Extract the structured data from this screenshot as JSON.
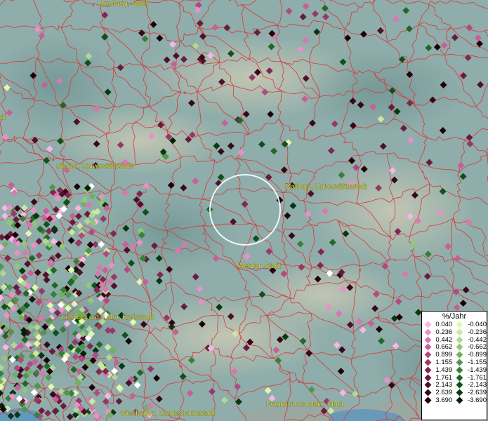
{
  "legend": {
    "title": "%/Jahr",
    "rows": [
      {
        "pos": "0.040",
        "pos_color": "#f6b6e6",
        "neg": "-0.040",
        "neg_color": "#e6f6b0"
      },
      {
        "pos": "0.236",
        "pos_color": "#e890c8",
        "neg": "-0.236",
        "neg_color": "#cce8a0"
      },
      {
        "pos": "0.442",
        "pos_color": "#d878b0",
        "neg": "-0.442",
        "neg_color": "#b0d890"
      },
      {
        "pos": "0.662",
        "pos_color": "#c86098",
        "neg": "-0.662",
        "neg_color": "#90c878"
      },
      {
        "pos": "0.899",
        "pos_color": "#b04a80",
        "neg": "-0.899",
        "neg_color": "#70b060"
      },
      {
        "pos": "1.155",
        "pos_color": "#983868",
        "neg": "-1.155",
        "neg_color": "#509848"
      },
      {
        "pos": "1.439",
        "pos_color": "#802850",
        "neg": "-1.439",
        "neg_color": "#388038"
      },
      {
        "pos": "1.761",
        "pos_color": "#681c3c",
        "neg": "-1.761",
        "neg_color": "#206828"
      },
      {
        "pos": "2.143",
        "pos_color": "#501028",
        "neg": "-2.143",
        "neg_color": "#10501a"
      },
      {
        "pos": "2.639",
        "pos_color": "#380818",
        "neg": "-2.639",
        "neg_color": "#083810"
      },
      {
        "pos": "3.690",
        "pos_color": "#200008",
        "neg": "-3.690",
        "neg_color": "#032008"
      }
    ]
  },
  "cities": [
    {
      "id": "arnsberg",
      "label": "Arnsberg, Stadt"
    },
    {
      "id": "siegen",
      "label": "Siegen, Universitätsstadt"
    },
    {
      "id": "marburg",
      "label": "Marburg, Universitätsstadt"
    },
    {
      "id": "wetzlar",
      "label": "Wetzlar, Stadt"
    },
    {
      "id": "limburg",
      "label": "Limburg a.d. Lahn, Kreisstadt"
    },
    {
      "id": "wiesbaden",
      "label": "Wiesbaden, Landeshauptstadt"
    },
    {
      "id": "frankfurt",
      "label": "Frankfurt am Main, Stadt"
    },
    {
      "id": "edge-left-1",
      "label": "dt"
    },
    {
      "id": "edge-left-2",
      "label": "t"
    }
  ],
  "colors": {
    "border": "#d83838",
    "label": "#e8e030",
    "water": "#4a90c8"
  }
}
